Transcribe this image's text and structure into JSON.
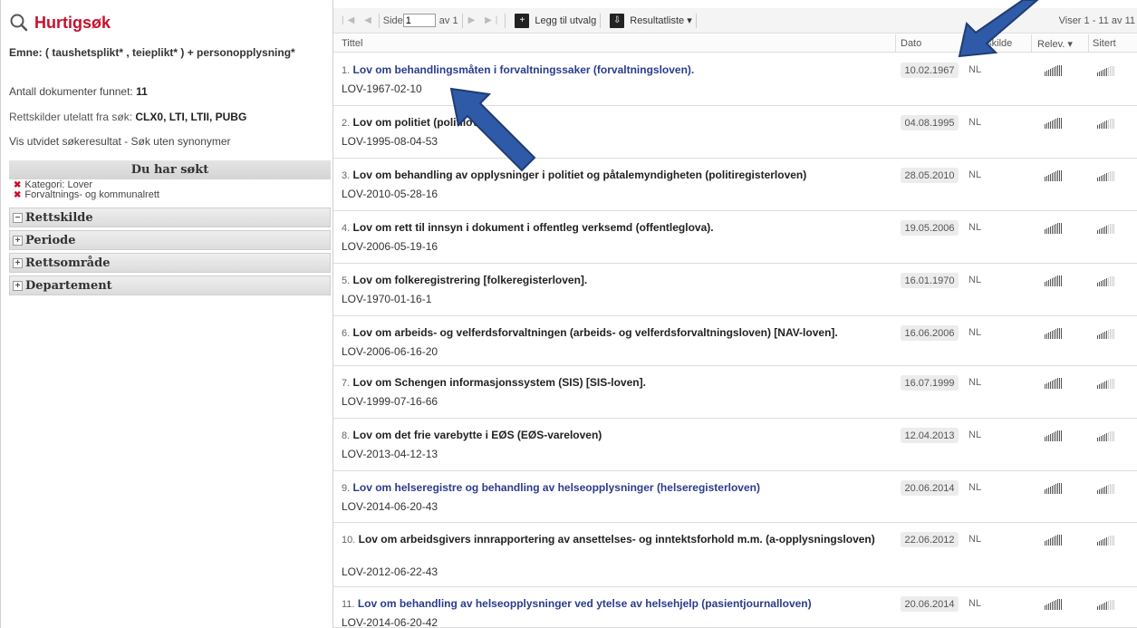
{
  "sidebar": {
    "title": "Hurtigsøk",
    "emne": "Emne: ( taushetsplikt* , teieplikt* ) + personopplysning*",
    "antall_label": "Antall dokumenter funnet:",
    "antall_value": "11",
    "utelatt_label": "Rettskilder utelatt fra søk:",
    "utelatt_value": "CLX0, LTI, LTII, PUBG",
    "utvidet": "Vis utvidet søkeresultat - Søk uten synonymer",
    "du_har_sokt": "Du har søkt",
    "filters": [
      "Kategori: Lover",
      "Forvaltnings- og kommunalrett"
    ],
    "facets": [
      {
        "sign": "−",
        "label": "Rettskilde"
      },
      {
        "sign": "+",
        "label": "Periode"
      },
      {
        "sign": "+",
        "label": "Rettsområde"
      },
      {
        "sign": "+",
        "label": "Departement"
      }
    ]
  },
  "toolbar": {
    "page_label": "Side",
    "page_value": "1",
    "page_of": "av 1",
    "add_label": "Legg til utvalg",
    "results_label": "Resultatliste ▾",
    "viser": "Viser 1 - 11 av 11"
  },
  "columns": {
    "tittel": "Tittel",
    "dato": "Dato",
    "rettskilde": "Rettskilde",
    "relev": "Relev. ▾",
    "sitert": "Sitert"
  },
  "rows": [
    {
      "num": "1.",
      "title": "Lov om behandlingsmåten i forvaltningssaker (forvaltningsloven).",
      "id": "LOV-1967-02-10",
      "date": "10.02.1967",
      "src": "NL",
      "blue": true
    },
    {
      "num": "2.",
      "title": "Lov om politiet (politiloven).",
      "id": "LOV-1995-08-04-53",
      "date": "04.08.1995",
      "src": "NL",
      "blue": false
    },
    {
      "num": "3.",
      "title": "Lov om behandling av opplysninger i politiet og påtalemyndigheten (politiregisterloven)",
      "id": "LOV-2010-05-28-16",
      "date": "28.05.2010",
      "src": "NL",
      "blue": false
    },
    {
      "num": "4.",
      "title": "Lov om rett til innsyn i dokument i offentleg verksemd (offentleglova).",
      "id": "LOV-2006-05-19-16",
      "date": "19.05.2006",
      "src": "NL",
      "blue": false
    },
    {
      "num": "5.",
      "title": "Lov om folkeregistrering [folkeregisterloven].",
      "id": "LOV-1970-01-16-1",
      "date": "16.01.1970",
      "src": "NL",
      "blue": false
    },
    {
      "num": "6.",
      "title": "Lov om arbeids- og velferdsforvaltningen (arbeids- og velferdsforvaltningsloven) [NAV-loven].",
      "id": "LOV-2006-06-16-20",
      "date": "16.06.2006",
      "src": "NL",
      "blue": false
    },
    {
      "num": "7.",
      "title": "Lov om Schengen informasjonssystem (SIS) [SIS-loven].",
      "id": "LOV-1999-07-16-66",
      "date": "16.07.1999",
      "src": "NL",
      "blue": false
    },
    {
      "num": "8.",
      "title": "Lov om det frie varebytte i EØS (EØS-vareloven)",
      "id": "LOV-2013-04-12-13",
      "date": "12.04.2013",
      "src": "NL",
      "blue": false
    },
    {
      "num": "9.",
      "title": "Lov om helseregistre og behandling av helseopplysninger (helseregisterloven)",
      "id": "LOV-2014-06-20-43",
      "date": "20.06.2014",
      "src": "NL",
      "blue": true
    },
    {
      "num": "10.",
      "title": "Lov om arbeidsgivers innrapportering av ansettelses- og inntektsforhold m.m. (a-opplysningsloven)",
      "id": "LOV-2012-06-22-43",
      "date": "22.06.2012",
      "src": "NL",
      "blue": false
    },
    {
      "num": "11.",
      "title": "Lov om behandling av helseopplysninger ved ytelse av helsehjelp (pasientjournalloven)",
      "id": "LOV-2014-06-20-42",
      "date": "20.06.2014",
      "src": "NL",
      "blue": true
    }
  ],
  "colors": {
    "accent_red": "#c8102e",
    "link_blue": "#2a3c8c",
    "arrow_blue": "#2f5aa8"
  }
}
